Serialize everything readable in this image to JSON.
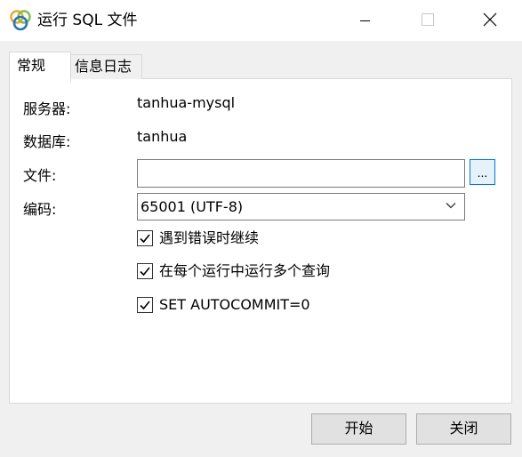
{
  "window": {
    "title": "运行 SQL 文件"
  },
  "tabs": [
    {
      "label": "常规",
      "active": true
    },
    {
      "label": "信息日志",
      "active": false
    }
  ],
  "form": {
    "server_label": "服务器:",
    "server_value": "tanhua-mysql",
    "database_label": "数据库:",
    "database_value": "tanhua",
    "file_label": "文件:",
    "file_value": "",
    "browse_label": "...",
    "encoding_label": "编码:",
    "encoding_value": "65001 (UTF-8)"
  },
  "options": [
    {
      "label": "遇到错误时继续",
      "checked": true
    },
    {
      "label": "在每个运行中运行多个查询",
      "checked": true
    },
    {
      "label": "SET AUTOCOMMIT=0",
      "checked": true
    }
  ],
  "buttons": {
    "start": "开始",
    "close": "关闭"
  },
  "colors": {
    "focus_border": "#0078d7",
    "button_face": "#e1e1e1",
    "window_bg": "#f0f0f0",
    "icon_green": "#7bc24a",
    "icon_blue": "#2a73b8",
    "icon_orange": "#f2a234"
  }
}
